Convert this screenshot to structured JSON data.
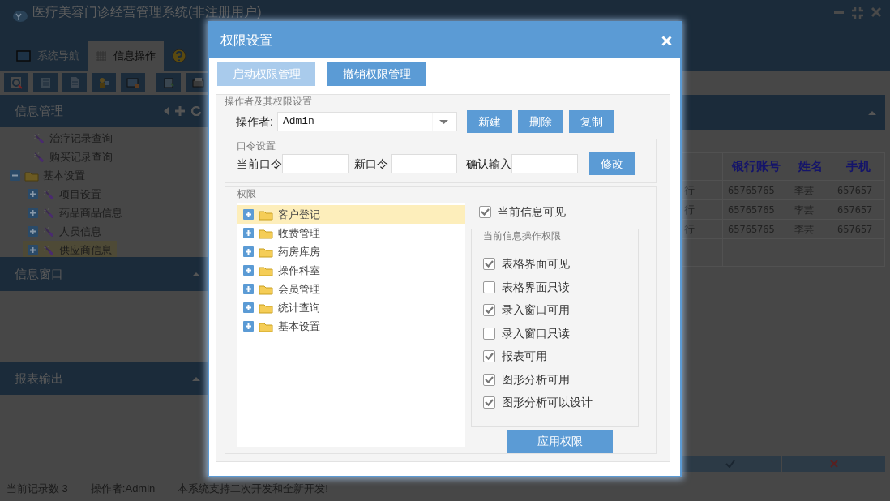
{
  "app": {
    "title": "医疗美容门诊经营管理系统(非注册用户)",
    "tabs": [
      {
        "label": "系统导航",
        "selected": false
      },
      {
        "label": "信息操作",
        "selected": true
      },
      {
        "selected": false
      }
    ]
  },
  "sidebar": {
    "panels": [
      {
        "title": "信息管理",
        "tree": [
          {
            "label": "治疗记录查询",
            "kind": "leaf",
            "selected": false
          },
          {
            "label": "购买记录查询",
            "kind": "leaf",
            "selected": false
          },
          {
            "label": "基本设置",
            "kind": "folder",
            "expanded": true,
            "selected": false,
            "children": [
              {
                "label": "项目设置",
                "kind": "branch",
                "selected": false
              },
              {
                "label": "药品商品信息",
                "kind": "branch",
                "selected": false
              },
              {
                "label": "人员信息",
                "kind": "branch",
                "selected": false
              },
              {
                "label": "供应商信息",
                "kind": "branch",
                "selected": true
              }
            ]
          }
        ]
      },
      {
        "title": "信息窗口",
        "expanded": true
      },
      {
        "title": "报表输出",
        "expanded": true
      }
    ]
  },
  "table": {
    "columns": [
      {
        "label": "银行账号"
      },
      {
        "label": "姓名"
      },
      {
        "label": "手机"
      }
    ],
    "rows": [
      {
        "column_1": "行",
        "cells": [
          "65765765",
          "李芸",
          "657657"
        ]
      },
      {
        "column_1": "行",
        "cells": [
          "65765765",
          "李芸",
          "657657"
        ]
      },
      {
        "column_1": "行",
        "cells": [
          "65765765",
          "李芸",
          "657657"
        ]
      }
    ]
  },
  "status_bar": [
    "当前记录数 3",
    "操作者:Admin",
    "本系统支持二次开发和全新开发!"
  ],
  "dialog": {
    "title": "权限设置",
    "top_buttons": [
      {
        "label": "启动权限管理",
        "disabled": true
      },
      {
        "label": "撤销权限管理",
        "disabled": false
      }
    ],
    "operator_group": {
      "legend": "操作者及其权限设置",
      "operator_label": "操作者:",
      "operator_value": "Admin",
      "buttons": [
        "新建",
        "删除",
        "复制"
      ]
    },
    "password_group": {
      "legend": "口令设置",
      "fields": [
        {
          "label": "当前口令"
        },
        {
          "label": "新口令"
        },
        {
          "label": "确认输入"
        }
      ],
      "button": "修改"
    },
    "permissions": {
      "legend": "权限",
      "tree": [
        {
          "label": "客户登记",
          "selected": true
        },
        {
          "label": "收费管理",
          "selected": false
        },
        {
          "label": "药房库房",
          "selected": false
        },
        {
          "label": "操作科室",
          "selected": false
        },
        {
          "label": "会员管理",
          "selected": false
        },
        {
          "label": "统计查询",
          "selected": false
        },
        {
          "label": "基本设置",
          "selected": false
        }
      ],
      "visible": {
        "label": "当前信息可见",
        "checked": true
      },
      "ops_legend": "当前信息操作权限",
      "ops": [
        {
          "label": "表格界面可见",
          "checked": true
        },
        {
          "label": "表格界面只读",
          "checked": false
        },
        {
          "label": "录入窗口可用",
          "checked": true
        },
        {
          "label": "录入窗口只读",
          "checked": false
        },
        {
          "label": "报表可用",
          "checked": true
        },
        {
          "label": "图形分析可用",
          "checked": true
        },
        {
          "label": "图形分析可以设计",
          "checked": true
        }
      ],
      "apply_button": "应用权限"
    }
  }
}
